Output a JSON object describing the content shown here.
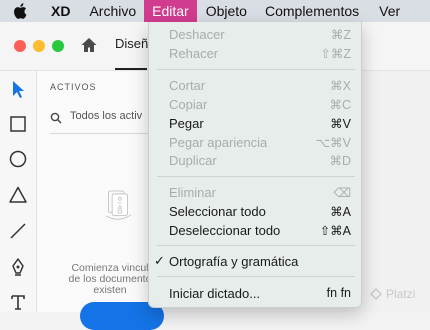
{
  "menubar": {
    "apple_icon": "apple-logo-icon",
    "app_name": "XD",
    "items": [
      "Archivo",
      "Editar",
      "Objeto",
      "Complementos",
      "Ver"
    ],
    "active_item": "Editar",
    "active_color": "#d13c8f"
  },
  "window": {
    "traffic_colors": [
      "#fe5f57",
      "#febc2e",
      "#28c840"
    ],
    "tab_label": "Diseñ",
    "home_icon": "home-icon"
  },
  "toolbar": {
    "tools": [
      "select-arrow-icon",
      "rectangle-icon",
      "ellipse-icon",
      "triangle-icon",
      "line-icon",
      "pen-icon",
      "text-icon"
    ]
  },
  "assets": {
    "title": "ACTIVOS",
    "search_placeholder": "Todos los activ",
    "help_line1": "Comienza vincul",
    "help_line2": "de los documento",
    "help_line3": "existen"
  },
  "edit_menu": {
    "deshacer": {
      "label": "Deshacer",
      "shortcut": "⌘Z"
    },
    "rehacer": {
      "label": "Rehacer",
      "shortcut": "⇧⌘Z"
    },
    "cortar": {
      "label": "Cortar",
      "shortcut": "⌘X"
    },
    "copiar": {
      "label": "Copiar",
      "shortcut": "⌘C"
    },
    "pegar": {
      "label": "Pegar",
      "shortcut": "⌘V"
    },
    "pegar_apariencia": {
      "label": "Pegar apariencia",
      "shortcut": "⌥⌘V"
    },
    "duplicar": {
      "label": "Duplicar",
      "shortcut": "⌘D"
    },
    "eliminar": {
      "label": "Eliminar",
      "shortcut": "⌫"
    },
    "seleccionar_todo": {
      "label": "Seleccionar todo",
      "shortcut": "⌘A"
    },
    "deseleccionar_todo": {
      "label": "Deseleccionar todo",
      "shortcut": "⇧⌘A"
    },
    "ortografia": {
      "label": "Ortografía y gramática",
      "checked": true
    },
    "dictado": {
      "label": "Iniciar dictado...",
      "shortcut": "fn fn"
    }
  },
  "watermark": "Platzi"
}
